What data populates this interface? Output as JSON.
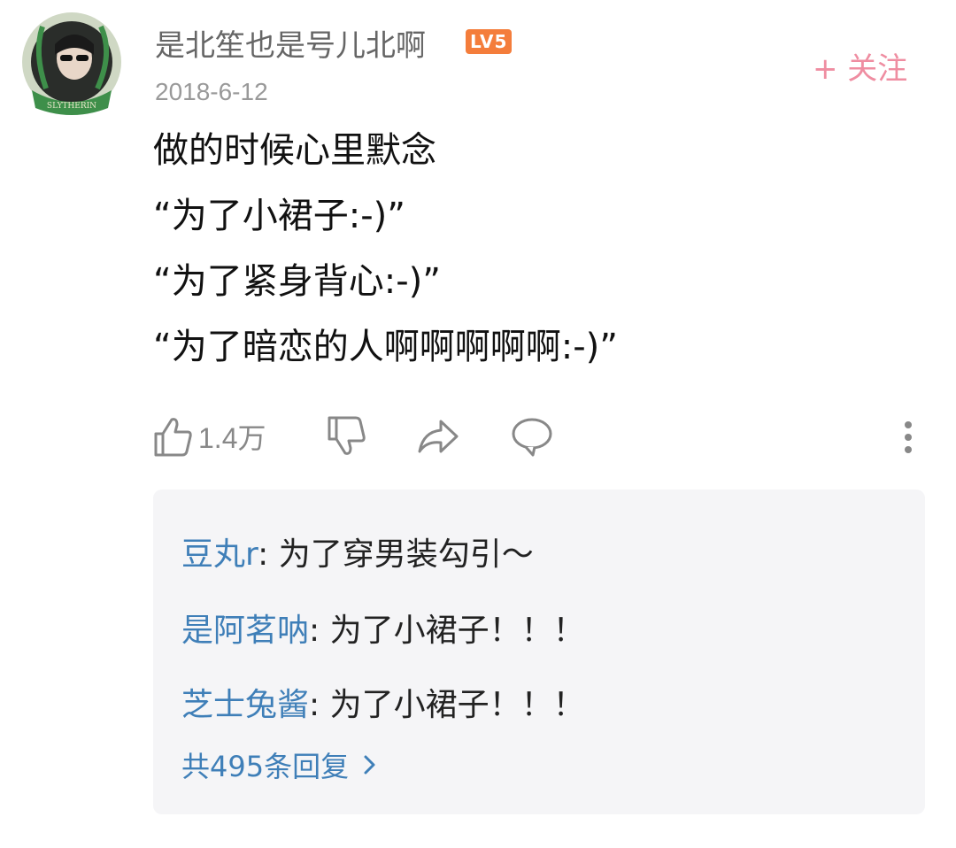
{
  "comment": {
    "username": "是北笙也是号儿北啊",
    "level_badge": "LV5",
    "follow_label": "+ 关注",
    "date": "2018-6-12",
    "avatar_text": "SLYTHERIN",
    "lines": [
      "做的时候心里默念",
      "“为了小裙子:-)”",
      "“为了紧身背心:-)”",
      "“为了暗恋的人啊啊啊啊啊:-)”"
    ]
  },
  "actions": {
    "like_count": "1.4万",
    "icons": [
      "thumbs-up-icon",
      "thumbs-down-icon",
      "share-icon",
      "comment-icon",
      "more-icon"
    ]
  },
  "replies": {
    "items": [
      {
        "name": "豆丸r",
        "text": ": 为了穿男装勾引～"
      },
      {
        "name": "是阿茗呐",
        "text": ": 为了小裙子！！！"
      },
      {
        "name": "芝士兔酱",
        "text": ": 为了小裙子！！！"
      }
    ],
    "more_label": "共495条回复"
  },
  "colors": {
    "accent_pink": "#ef8da1",
    "link_blue": "#3f7fb8",
    "badge_orange": "#f47d3b"
  }
}
